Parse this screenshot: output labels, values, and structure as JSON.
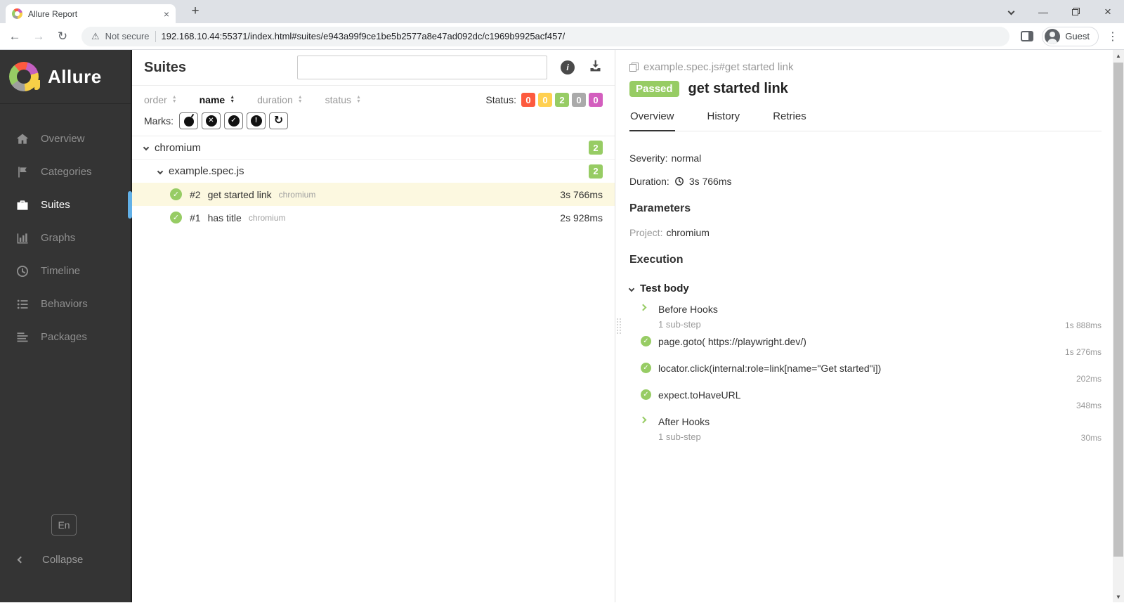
{
  "browser": {
    "tab_title": "Allure Report",
    "not_secure": "Not secure",
    "url": "192.168.10.44:55371/index.html#suites/e943a99f9ce1be5b2577a8e47ad092dc/c1969b9925acf457/",
    "guest_label": "Guest"
  },
  "icons": {
    "close": "×",
    "plus": "+",
    "minimize": "—",
    "back": "←",
    "forward": "→",
    "reload": "↻",
    "warning": "⚠",
    "kebab": "⋮",
    "info": "i",
    "check": "✓",
    "cross": "✕",
    "bang": "!",
    "sort_up": "▲",
    "sort_down": "▼",
    "scroll_up": "▲",
    "scroll_down": "▼"
  },
  "sidebar": {
    "brand": "Allure",
    "items": [
      {
        "label": "Overview"
      },
      {
        "label": "Categories"
      },
      {
        "label": "Suites"
      },
      {
        "label": "Graphs"
      },
      {
        "label": "Timeline"
      },
      {
        "label": "Behaviors"
      },
      {
        "label": "Packages"
      }
    ],
    "language": "En",
    "collapse": "Collapse"
  },
  "suites": {
    "title": "Suites",
    "search_value": "",
    "sort": {
      "order": "order",
      "name": "name",
      "duration": "duration",
      "status": "status"
    },
    "status_label": "Status:",
    "counts": {
      "failed": "0",
      "broken": "0",
      "passed": "2",
      "skipped": "0",
      "unknown": "0"
    },
    "marks_label": "Marks:",
    "tree": {
      "group": {
        "name": "chromium",
        "count": "2"
      },
      "subgroup": {
        "name": "example.spec.js",
        "count": "2"
      },
      "tests": [
        {
          "num": "#2",
          "name": "get started link",
          "tag": "chromium",
          "duration": "3s 766ms"
        },
        {
          "num": "#1",
          "name": "has title",
          "tag": "chromium",
          "duration": "2s 928ms"
        }
      ]
    }
  },
  "detail": {
    "breadcrumb": "example.spec.js#get started link",
    "status_badge": "Passed",
    "title": "get started link",
    "tabs": [
      {
        "label": "Overview"
      },
      {
        "label": "History"
      },
      {
        "label": "Retries"
      }
    ],
    "severity_label": "Severity:",
    "severity_value": "normal",
    "duration_label": "Duration:",
    "duration_value": "3s 766ms",
    "parameters_heading": "Parameters",
    "project_label": "Project:",
    "project_value": "chromium",
    "execution_heading": "Execution",
    "test_body_label": "Test body",
    "steps": [
      {
        "name": "Before Hooks",
        "substep": "1 sub-step",
        "duration": "1s 888ms"
      },
      {
        "name": "page.goto( https://playwright.dev/)",
        "duration": "1s 276ms"
      },
      {
        "name": "locator.click(internal:role=link[name=\"Get started\"i])",
        "duration": "202ms"
      },
      {
        "name": "expect.toHaveURL",
        "duration": "348ms"
      },
      {
        "name": "After Hooks",
        "substep": "1 sub-step",
        "duration": "30ms"
      }
    ]
  },
  "colors": {
    "passed": "#97cc64",
    "failed": "#fd5a3e",
    "broken": "#ffd050",
    "skipped": "#aaaaaa",
    "unknown": "#d35ebe",
    "accent": "#61b0e7",
    "sidebar_bg": "#343434",
    "selected_row": "#fcf8e0"
  }
}
